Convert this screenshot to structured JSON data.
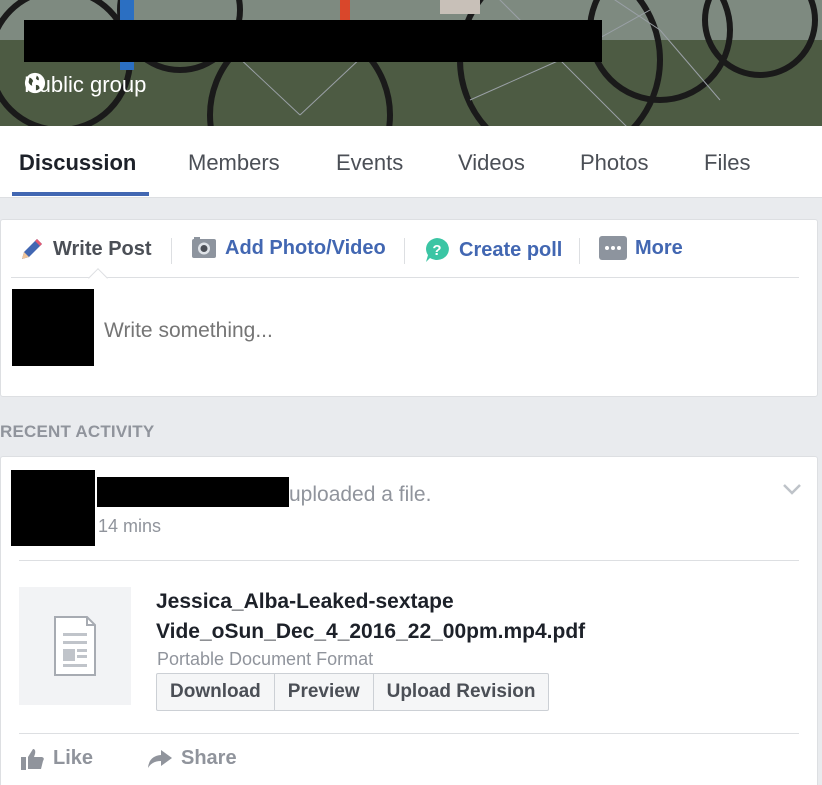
{
  "group": {
    "privacy_label": "Public group"
  },
  "tabs": [
    {
      "label": "Discussion",
      "active": true
    },
    {
      "label": "Members"
    },
    {
      "label": "Events"
    },
    {
      "label": "Videos"
    },
    {
      "label": "Photos"
    },
    {
      "label": "Files"
    }
  ],
  "composer": {
    "write_post": "Write Post",
    "add_photo": "Add Photo/Video",
    "create_poll": "Create poll",
    "more": "More",
    "placeholder": "Write something..."
  },
  "recent_activity_label": "RECENT ACTIVITY",
  "post": {
    "action_text": "uploaded a file.",
    "time": "14 mins",
    "file_name_line1": "Jessica_Alba-Leaked-sextape",
    "file_name_line2": "Vide_oSun_Dec_4_2016_22_00pm.mp4.pdf",
    "file_type": "Portable Document Format",
    "buttons": {
      "download": "Download",
      "preview": "Preview",
      "upload_revision": "Upload Revision"
    },
    "like": "Like",
    "share": "Share"
  },
  "colors": {
    "accent": "#4267b2",
    "page_bg": "#e9ebee",
    "muted_text": "#90949c",
    "poll_icon": "#3bc5a4"
  },
  "icons": {
    "privacy": "globe-icon",
    "write": "pencil-icon",
    "photo": "camera-icon",
    "poll": "poll-bubble-icon",
    "more": "more-dots-icon",
    "post_menu": "chevron-down-icon",
    "file": "document-icon",
    "like": "thumbs-up-icon",
    "share": "share-arrow-icon"
  }
}
